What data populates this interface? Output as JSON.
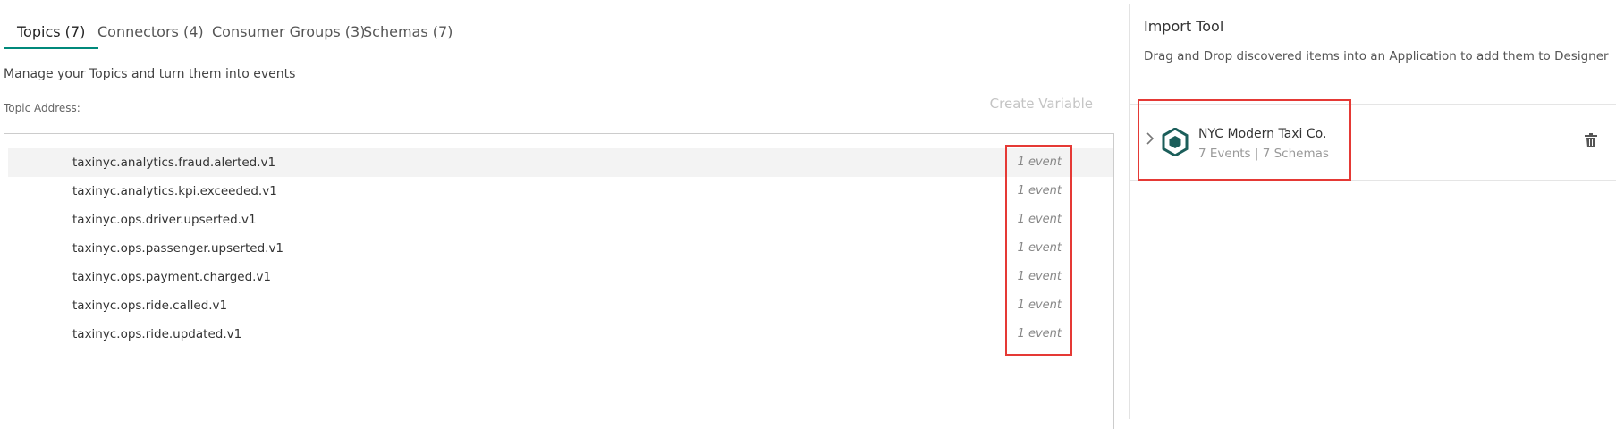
{
  "tabs": [
    {
      "label": "Topics (7)",
      "active": true
    },
    {
      "label": "Connectors (4)",
      "active": false
    },
    {
      "label": "Consumer Groups (3)",
      "active": false
    },
    {
      "label": "Schemas (7)",
      "active": false
    }
  ],
  "topics": {
    "description": "Manage your Topics and turn them into events",
    "address_label": "Topic Address:",
    "create_variable_label": "Create Variable",
    "rows": [
      {
        "name": "taxinyc.analytics.fraud.alerted.v1",
        "count": "1 event",
        "highlighted": true
      },
      {
        "name": "taxinyc.analytics.kpi.exceeded.v1",
        "count": "1 event",
        "highlighted": false
      },
      {
        "name": "taxinyc.ops.driver.upserted.v1",
        "count": "1 event",
        "highlighted": false
      },
      {
        "name": "taxinyc.ops.passenger.upserted.v1",
        "count": "1 event",
        "highlighted": false
      },
      {
        "name": "taxinyc.ops.payment.charged.v1",
        "count": "1 event",
        "highlighted": false
      },
      {
        "name": "taxinyc.ops.ride.called.v1",
        "count": "1 event",
        "highlighted": false
      },
      {
        "name": "taxinyc.ops.ride.updated.v1",
        "count": "1 event",
        "highlighted": false
      }
    ]
  },
  "import_tool": {
    "title": "Import Tool",
    "description": "Drag and Drop discovered items into an Application to add them to Designer",
    "application": {
      "name": "NYC Modern Taxi Co.",
      "meta": "7 Events | 7 Schemas",
      "icon": "hexagon-app-icon",
      "expand_icon": "chevron-right-icon",
      "delete_icon": "trash-icon"
    }
  },
  "colors": {
    "accent": "#00897b",
    "app_icon": "#1b5e5a",
    "highlight_box": "#e53935"
  }
}
